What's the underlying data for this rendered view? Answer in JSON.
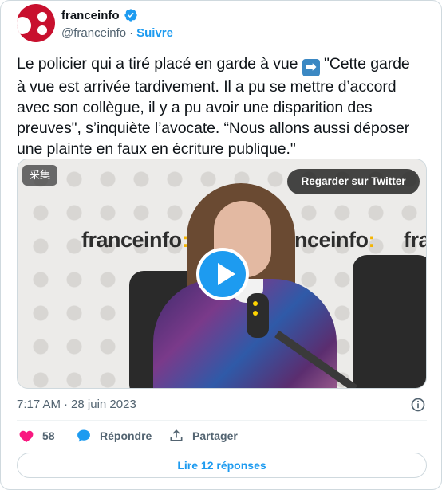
{
  "author": {
    "name": "franceinfo",
    "handle": "@franceinfo",
    "separator": "·",
    "follow_label": "Suivre",
    "verified": true
  },
  "tweet": {
    "text_before_emoji": "Le policier qui a tiré placé en garde à vue ",
    "emoji": "right-arrow-emoji",
    "text_after_emoji": " \"Cette garde à vue est arrivée tardivement. Il a pu se mettre d’accord avec son collègue, il y a pu avoir une disparition des preuves\", s’inquiète l’avocate. “Nous allons aussi déposer une plainte en faux en écriture publique.\""
  },
  "media": {
    "badge": "采集",
    "watch_label": "Regarder sur Twitter",
    "brand_text_1": "franceinfo",
    "brand_text_2": "franceinfo",
    "brand_text_3": "franceinfo",
    "brand_text_4": "fra",
    "brand_colon": ":"
  },
  "meta": {
    "time": "7:17 AM",
    "separator": "·",
    "date": "28 juin 2023"
  },
  "actions": {
    "like_count": "58",
    "reply_label": "Répondre",
    "share_label": "Partager"
  },
  "read_replies_label": "Lire 12 réponses",
  "colors": {
    "accent": "#1d9bf0",
    "like": "#f91880",
    "brand_red": "#c8102e"
  }
}
